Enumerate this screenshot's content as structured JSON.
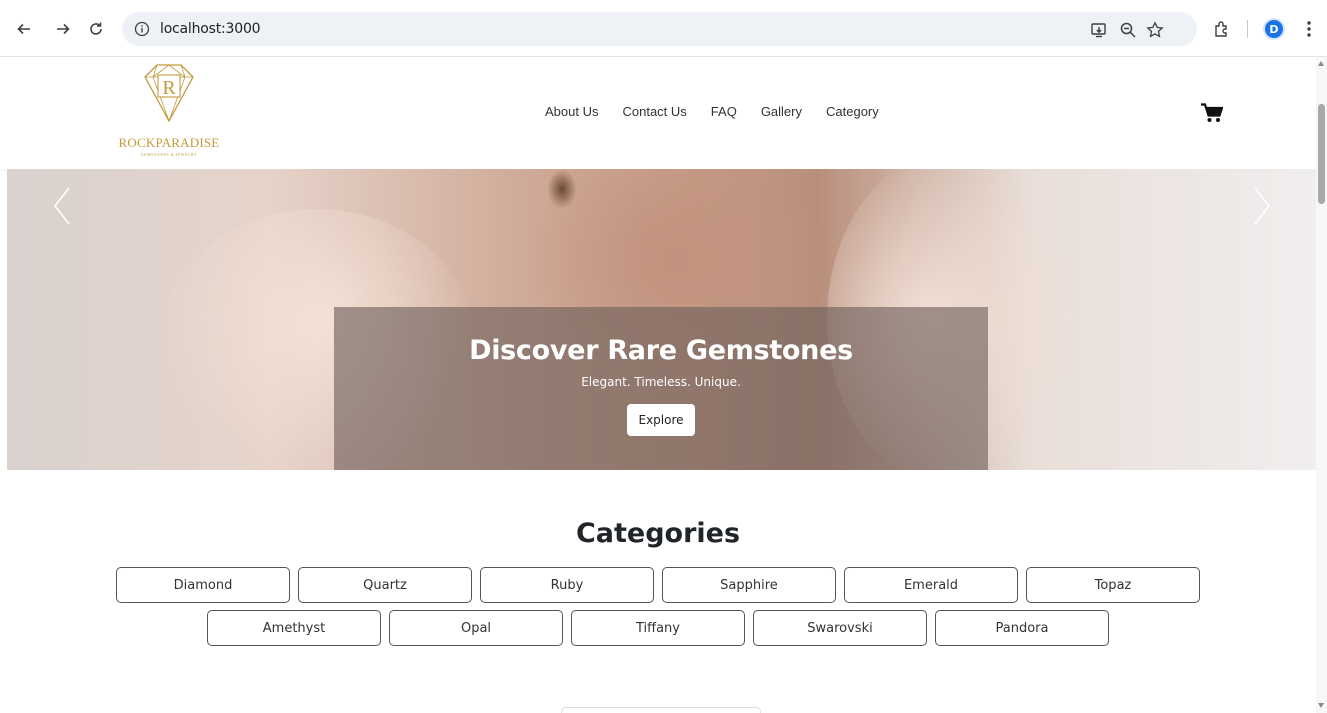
{
  "browser": {
    "url": "localhost:3000",
    "profile_initial": "D",
    "icons": [
      "back-icon",
      "forward-icon",
      "reload-icon",
      "site-info-icon",
      "install-icon",
      "zoom-icon",
      "bookmark-star-icon",
      "extensions-icon",
      "menu-dots-icon"
    ]
  },
  "site": {
    "brand_name": "ROCKPARADISE",
    "brand_tagline": "GEMSTONES & JEWELRY",
    "accent_color": "#c49a3c",
    "nav": [
      {
        "label": "About Us"
      },
      {
        "label": "Contact Us"
      },
      {
        "label": "FAQ"
      },
      {
        "label": "Gallery"
      },
      {
        "label": "Category"
      }
    ],
    "cart_icon": "cart-icon"
  },
  "hero": {
    "title": "Discover Rare Gemstones",
    "subtitle": "Elegant. Timeless. Unique.",
    "button_label": "Explore"
  },
  "categories": {
    "title": "Categories",
    "row1": [
      "Diamond",
      "Quartz",
      "Ruby",
      "Sapphire",
      "Emerald",
      "Topaz"
    ],
    "row2": [
      "Amethyst",
      "Opal",
      "Tiffany",
      "Swarovski",
      "Pandora"
    ]
  }
}
